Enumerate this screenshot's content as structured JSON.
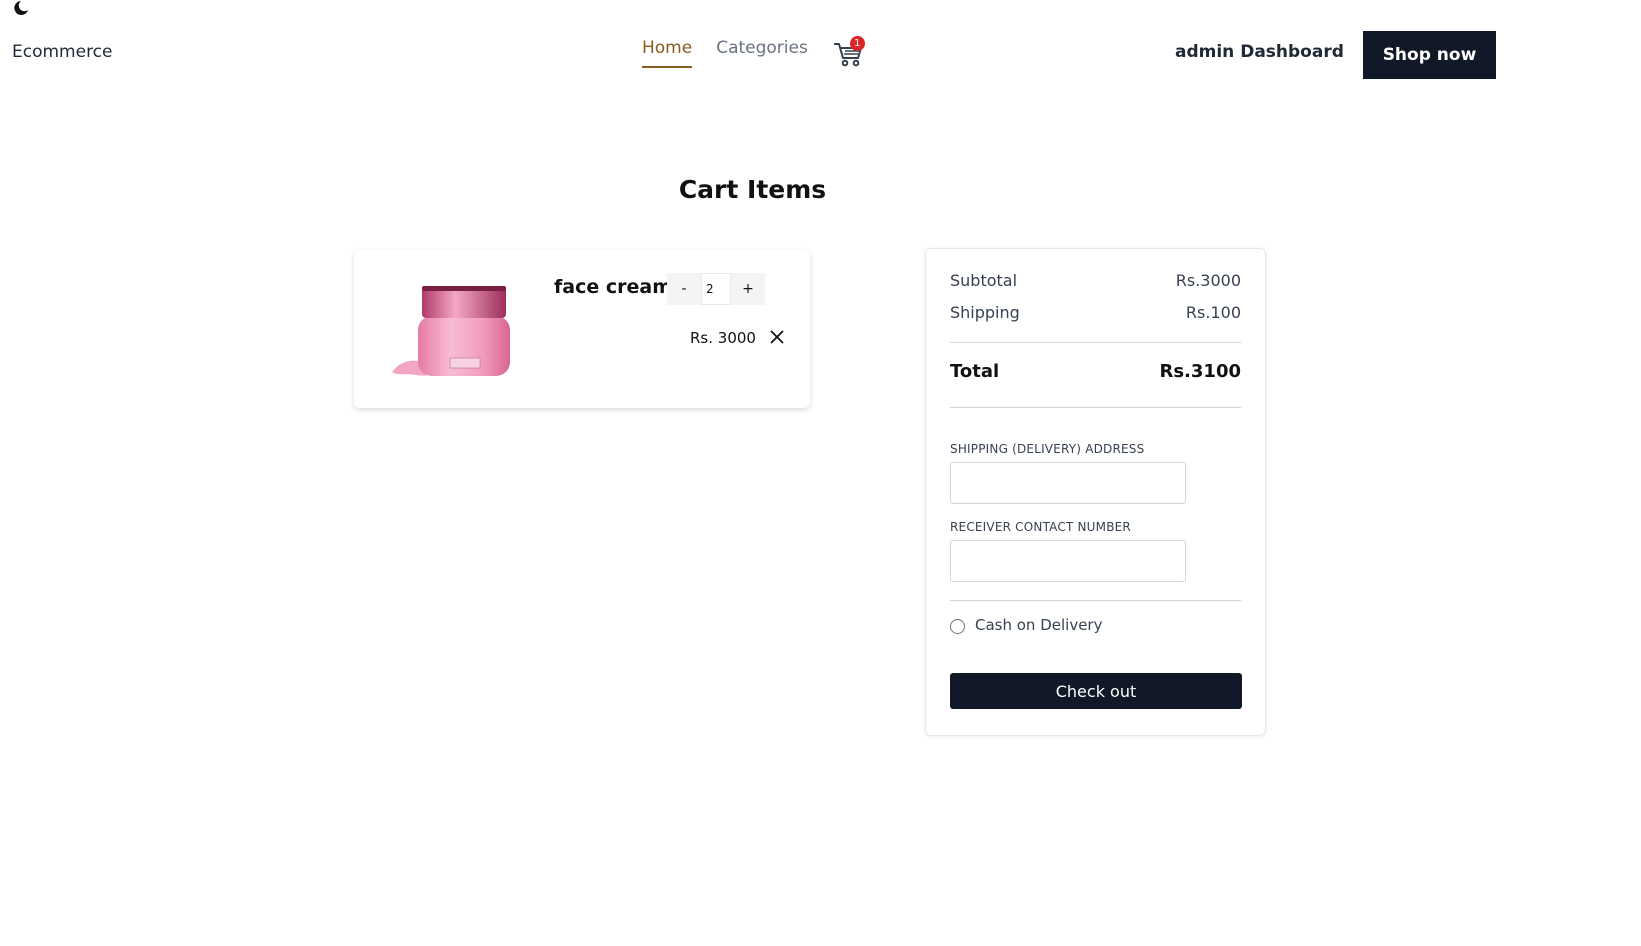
{
  "header": {
    "theme_icon": "moon-icon",
    "brand": "Ecommerce",
    "nav": [
      {
        "label": "Home",
        "active": true
      },
      {
        "label": "Categories",
        "active": false
      }
    ],
    "cart_icon": "cart-icon",
    "cart_count": "1",
    "admin_link": "admin Dashboard",
    "shop_button": "Shop now"
  },
  "page_title": "Cart Items",
  "cart_items": [
    {
      "name": "face cream",
      "quantity": "2",
      "minus_label": "-",
      "plus_label": "+",
      "price": "Rs. 3000",
      "image_icon": "face-cream-jar-image",
      "remove_icon": "close-icon"
    }
  ],
  "summary": {
    "subtotal_label": "Subtotal",
    "subtotal_value": "Rs.3000",
    "shipping_label": "Shipping",
    "shipping_value": "Rs.100",
    "total_label": "Total",
    "total_value": "Rs.3100",
    "address_label": "SHIPPING (DELIVERY) ADDRESS",
    "address_value": "",
    "contact_label": "RECEIVER CONTACT NUMBER",
    "contact_value": "",
    "payment_option": "Cash on Delivery",
    "checkout_button": "Check out"
  },
  "colors": {
    "accent": "#8a5a1e",
    "dark": "#111827",
    "badge": "#dc2626"
  }
}
